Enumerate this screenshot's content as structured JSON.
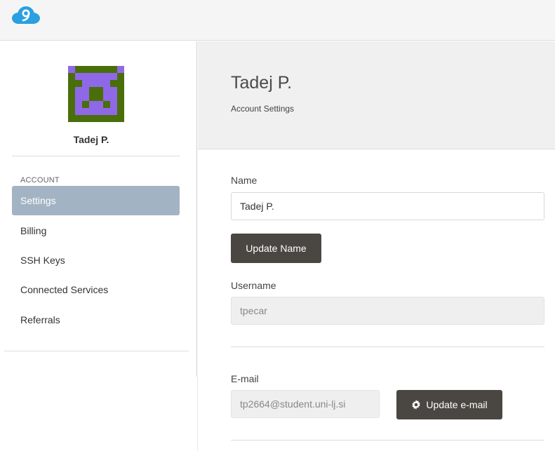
{
  "app": {
    "logo": "cloud9-logo-icon"
  },
  "profile": {
    "name": "Tadej P."
  },
  "sidebar": {
    "section_label": "ACCOUNT",
    "items": [
      {
        "label": "Settings",
        "active": true
      },
      {
        "label": "Billing",
        "active": false
      },
      {
        "label": "SSH Keys",
        "active": false
      },
      {
        "label": "Connected Services",
        "active": false
      },
      {
        "label": "Referrals",
        "active": false
      }
    ]
  },
  "header": {
    "title": "Tadej P.",
    "subtitle": "Account Settings"
  },
  "form": {
    "name_label": "Name",
    "name_value": "Tadej P.",
    "update_name_label": "Update Name",
    "username_label": "Username",
    "username_value": "tpecar",
    "email_label": "E-mail",
    "email_value": "tp2664@student.uni-lj.si",
    "update_email_label": "Update e-mail"
  },
  "colors": {
    "active_nav": "#a2b4c3",
    "button": "#4a4743",
    "logo_blue": "#2aa0e0",
    "avatar_bg": "#4a6e0a",
    "avatar_fg": "#8f68e8"
  }
}
